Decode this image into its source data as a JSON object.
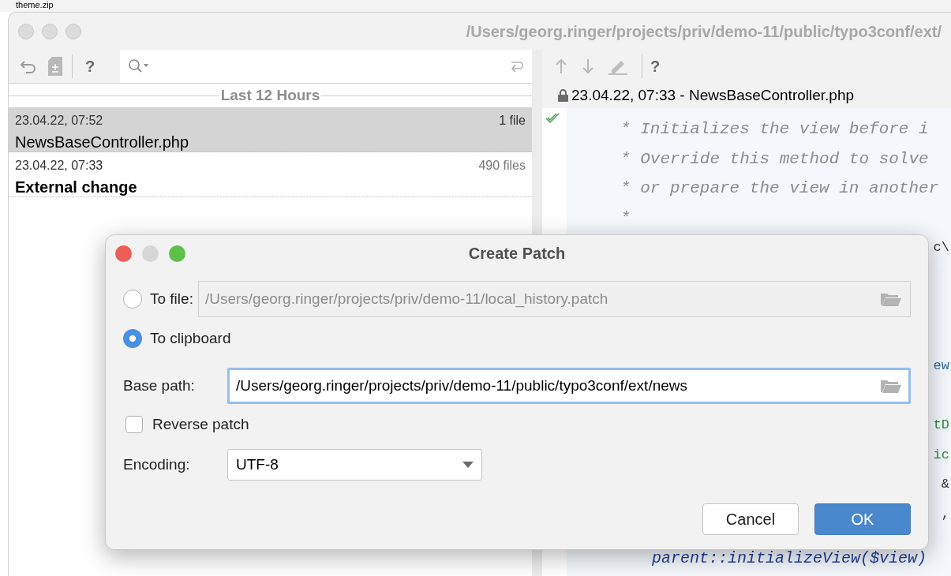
{
  "background_tab": {
    "label": "theme.zip"
  },
  "window": {
    "title": "/Users/georg.ringer/projects/priv/demo-11/public/typo3conf/ext/"
  },
  "toolbar": {
    "help": "?"
  },
  "history": {
    "group": "Last 12 Hours",
    "entries": [
      {
        "time": "23.04.22, 07:52",
        "count": "1 file",
        "title": "NewsBaseController.php",
        "kind": "file",
        "selected": true
      },
      {
        "time": "23.04.22, 07:33",
        "count": "490 files",
        "title": "External change",
        "kind": "external",
        "selected": false
      }
    ]
  },
  "diff": {
    "help": "?",
    "header": "23.04.22, 07:33 - NewsBaseController.php",
    "lines": [
      {
        "kind": "comment",
        "text": "* Initializes the view before i"
      },
      {
        "kind": "comment",
        "text": "* Override this method to solve"
      },
      {
        "kind": "comment",
        "text": "* or prepare the view in another"
      },
      {
        "kind": "comment",
        "text": "*"
      },
      {
        "kind": "fragment",
        "text": "c\\",
        "color": "#333333"
      },
      {
        "kind": "blank"
      },
      {
        "kind": "blank"
      },
      {
        "kind": "blank"
      },
      {
        "kind": "fragment",
        "text": "ew",
        "color": "#2d6e9e"
      },
      {
        "kind": "blank"
      },
      {
        "kind": "fragment",
        "text": "tD",
        "color": "#2e8b3a"
      },
      {
        "kind": "fragment",
        "text": "ic",
        "color": "#2e8b3a"
      },
      {
        "kind": "fragment",
        "text": "&",
        "color": "#333333"
      },
      {
        "kind": "fragment",
        "text": ",",
        "color": "#333333"
      },
      {
        "kind": "code",
        "text": "parent::initializeView($view)"
      }
    ]
  },
  "dialog": {
    "title": "Create Patch",
    "targets": [
      {
        "label": "To file:",
        "selected": false,
        "value": "/Users/georg.ringer/projects/priv/demo-11/local_history.patch",
        "disabled": true
      },
      {
        "label": "To clipboard",
        "selected": true
      }
    ],
    "base_path": {
      "label": "Base path:",
      "value": "/Users/georg.ringer/projects/priv/demo-11/public/typo3conf/ext/news"
    },
    "reverse_patch": {
      "label": "Reverse patch",
      "checked": false
    },
    "encoding": {
      "label": "Encoding:",
      "value": "UTF-8"
    },
    "buttons": [
      {
        "label": "Cancel",
        "kind": "default"
      },
      {
        "label": "OK",
        "kind": "primary"
      }
    ]
  }
}
